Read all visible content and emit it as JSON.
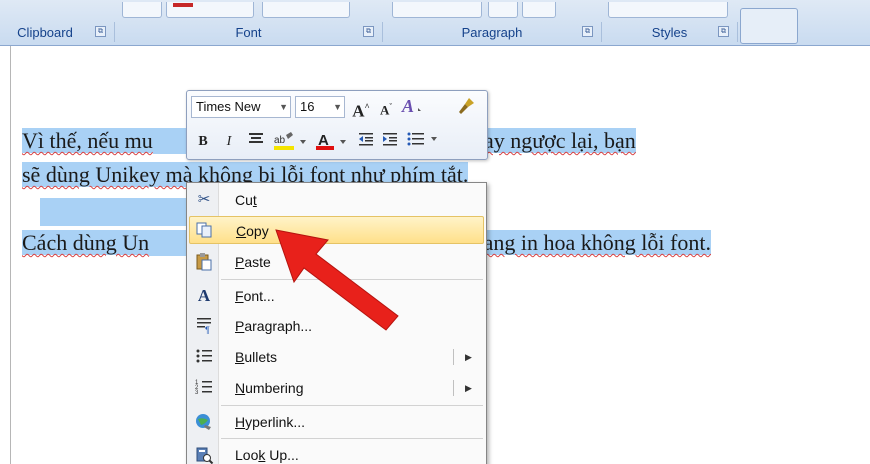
{
  "ribbon": {
    "groups": [
      {
        "label": "Clipboard",
        "launcher": "⧉"
      },
      {
        "label": "Font",
        "launcher": "⧉"
      },
      {
        "label": "Paragraph",
        "launcher": "⧉"
      },
      {
        "label": "Styles",
        "launcher": "⧉"
      }
    ]
  },
  "document": {
    "line1_a": "Vì thế, nếu mu",
    "line1_b": "g sang in hoa hay ngược lại, bạn",
    "line2": "sẽ dùng Unikey mà không bị lỗi font như phím tắt.",
    "line3_a": "Cách dùng Un",
    "line3_b": "sang in hoa không lỗi font."
  },
  "mini_toolbar": {
    "font_name": "Times New",
    "font_size": "16",
    "grow_font": "A",
    "shrink_font": "A",
    "bold": "B",
    "italic": "I"
  },
  "context_menu": {
    "items": [
      {
        "label_pre": "Cu",
        "label_u": "t",
        "label_post": "",
        "icon": "scissors-icon"
      },
      {
        "label_pre": "",
        "label_u": "C",
        "label_post": "opy",
        "icon": "copy-icon"
      },
      {
        "label_pre": "",
        "label_u": "P",
        "label_post": "aste",
        "icon": "paste-icon"
      },
      {
        "label_pre": "",
        "label_u": "F",
        "label_post": "ont...",
        "icon": "font-icon"
      },
      {
        "label_pre": "",
        "label_u": "P",
        "label_post": "aragraph...",
        "icon": "paragraph-icon"
      },
      {
        "label_pre": "",
        "label_u": "B",
        "label_post": "ullets",
        "icon": "bullets-icon"
      },
      {
        "label_pre": "",
        "label_u": "N",
        "label_post": "umbering",
        "icon": "numbering-icon"
      },
      {
        "label_pre": "",
        "label_u": "H",
        "label_post": "yperlink...",
        "icon": "hyperlink-icon"
      },
      {
        "label_pre": "Loo",
        "label_u": "k",
        "label_post": " Up...",
        "icon": "lookup-icon"
      }
    ]
  },
  "colors": {
    "selection": "#a9d1f5",
    "highlight": "#ffe08a",
    "arrow": "#e8211b",
    "ribbon_text": "#15428b"
  }
}
